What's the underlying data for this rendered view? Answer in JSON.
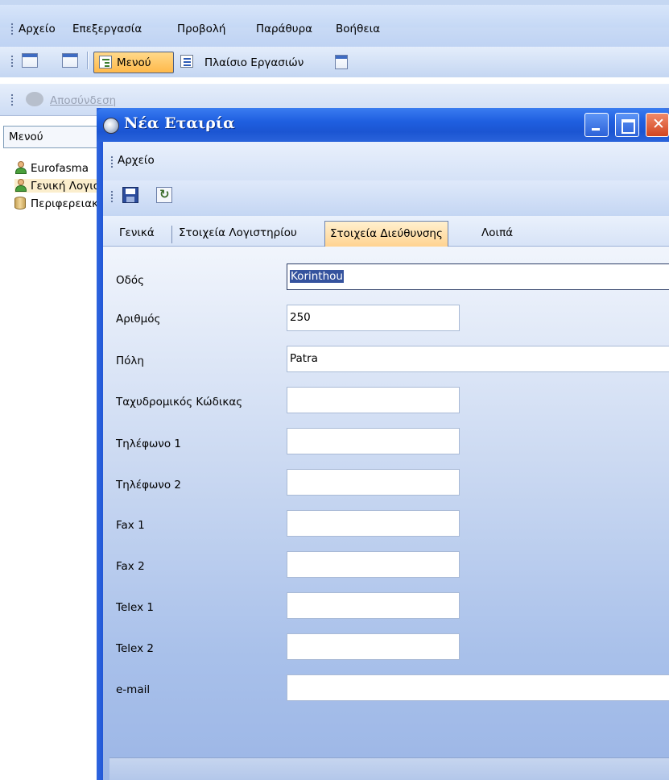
{
  "menubar": {
    "items": [
      "Αρχείο",
      "Επεξεργασία",
      "Προβολή",
      "Παράθυρα",
      "Βοήθεια"
    ]
  },
  "toolbar": {
    "menou_label": "Μενού",
    "plaisio_label": "Πλαίσιο Εργασιών"
  },
  "toolbar2": {
    "disabled_label": "Αποσύνδεση"
  },
  "left_panel": {
    "header": "Μενού",
    "items": [
      "Eurofasma",
      "Γενική Λογιστική",
      "Περιφερειακά"
    ]
  },
  "child_window": {
    "title": "Νέα Εταιρία",
    "menu_label": "Αρχείο",
    "tabs": [
      "Γενικά",
      "Στοιχεία Λογιστηρίου",
      "Στοιχεία Διεύθυνσης",
      "Λοιπά"
    ],
    "active_tab": "Στοιχεία Διεύθυνσης",
    "fields": [
      {
        "label": "Οδός",
        "value": "Korinthou"
      },
      {
        "label": "Αριθμός",
        "value": "250"
      },
      {
        "label": "Πόλη",
        "value": "Patra"
      },
      {
        "label": "Ταχυδρομικός Κώδικας",
        "value": ""
      },
      {
        "label": "Τηλέφωνο 1",
        "value": ""
      },
      {
        "label": "Τηλέφωνο 2",
        "value": ""
      },
      {
        "label": "Fax 1",
        "value": ""
      },
      {
        "label": "Fax 2",
        "value": ""
      },
      {
        "label": "Telex 1",
        "value": ""
      },
      {
        "label": "Telex 2",
        "value": ""
      },
      {
        "label": "e-mail",
        "value": ""
      }
    ]
  },
  "colors": {
    "title_blue": "#1f5fe0",
    "active_tab": "#ffd391",
    "selection": "#35539e"
  }
}
